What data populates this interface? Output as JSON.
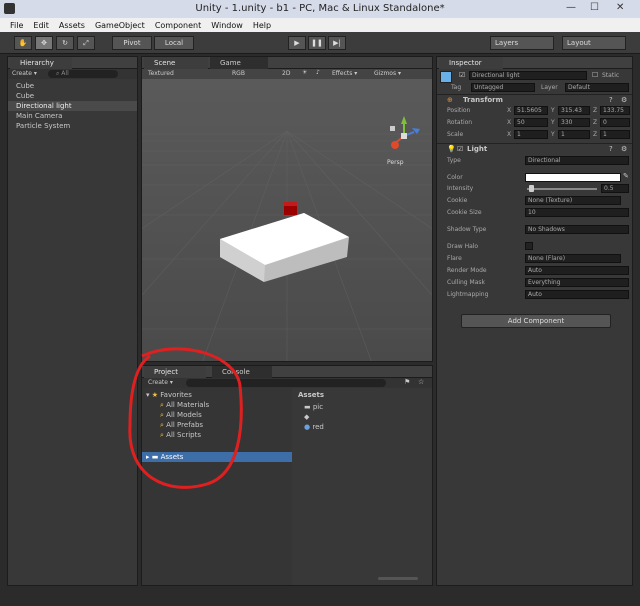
{
  "window": {
    "title": "Unity - 1.unity - b1 - PC, Mac & Linux Standalone*",
    "minimize": "—",
    "maximize": "☐",
    "close": "✕"
  },
  "menu": [
    "File",
    "Edit",
    "Assets",
    "GameObject",
    "Component",
    "Window",
    "Help"
  ],
  "toolbar": {
    "pivot": "Pivot",
    "local": "Local",
    "layers": "Layers",
    "layout": "Layout"
  },
  "hierarchy": {
    "tab": "Hierarchy",
    "create": "Create ▾",
    "search": "All",
    "items": [
      "Cube",
      "Cube",
      "Directional light",
      "Main Camera",
      "Particle System"
    ]
  },
  "scene": {
    "tab_scene": "Scene",
    "tab_game": "Game",
    "shading": "Textured",
    "render": "RGB",
    "mode": "2D",
    "effects": "Effects ▾",
    "gizmos": "Gizmos ▾",
    "persp": "Persp"
  },
  "project": {
    "tab_project": "Project",
    "tab_console": "Console",
    "create": "Create ▾",
    "favorites": "Favorites",
    "fav_items": [
      "All Materials",
      "All Models",
      "All Prefabs",
      "All Scripts"
    ],
    "assets": "Assets",
    "assets_header": "Assets",
    "asset_items": [
      "pic",
      "",
      "red"
    ]
  },
  "inspector": {
    "tab": "Inspector",
    "object_name": "Directional light",
    "static": "Static",
    "tag_label": "Tag",
    "tag_value": "Untagged",
    "layer_label": "Layer",
    "layer_value": "Default",
    "transform": {
      "title": "Transform",
      "rows": [
        {
          "label": "Position",
          "x": "51.5605",
          "y": "315.43",
          "z": "133.75"
        },
        {
          "label": "Rotation",
          "x": "50",
          "y": "330",
          "z": "0"
        },
        {
          "label": "Scale",
          "x": "1",
          "y": "1",
          "z": "1"
        }
      ]
    },
    "light": {
      "title": "Light",
      "type_label": "Type",
      "type_value": "Directional",
      "color_label": "Color",
      "intensity_label": "Intensity",
      "intensity_value": "0.5",
      "cookie_label": "Cookie",
      "cookie_value": "None (Texture)",
      "cookie_size_label": "Cookie Size",
      "cookie_size_value": "10",
      "shadow_label": "Shadow Type",
      "shadow_value": "No Shadows",
      "draw_halo_label": "Draw Halo",
      "flare_label": "Flare",
      "flare_value": "None (Flare)",
      "render_mode_label": "Render Mode",
      "render_mode_value": "Auto",
      "culling_label": "Culling Mask",
      "culling_value": "Everything",
      "lightmapping_label": "Lightmapping",
      "lightmapping_value": "Auto"
    },
    "add_component": "Add Component"
  },
  "colors": {
    "accent": "#3d6ea8",
    "annotation": "#e02020"
  }
}
